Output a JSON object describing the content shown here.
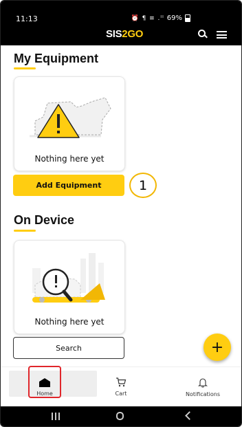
{
  "status_bar": {
    "time": "11:13",
    "indicators": "⏰ ¶ ≡ .ᴵᴵ",
    "battery": "69%"
  },
  "header": {
    "brand_part1": "SIS",
    "brand_part2": "2GO",
    "brand_accent_color": "#FFCD11"
  },
  "my_equipment": {
    "title": "My Equipment",
    "empty_text": "Nothing here yet",
    "add_button_label": "Add Equipment",
    "callout_number": "1"
  },
  "on_device": {
    "title": "On Device",
    "empty_text": "Nothing here yet",
    "search_button_label": "Search"
  },
  "fab": {
    "label": "+"
  },
  "bottom_nav": {
    "items": [
      {
        "label": "Home",
        "icon": "home-icon",
        "active": true
      },
      {
        "label": "Cart",
        "icon": "cart-icon",
        "active": false
      },
      {
        "label": "Notifications",
        "icon": "bell-icon",
        "active": false
      }
    ]
  },
  "colors": {
    "accent": "#FFCD11",
    "highlight_box": "#E0262B",
    "topbar_bg": "#000000"
  }
}
